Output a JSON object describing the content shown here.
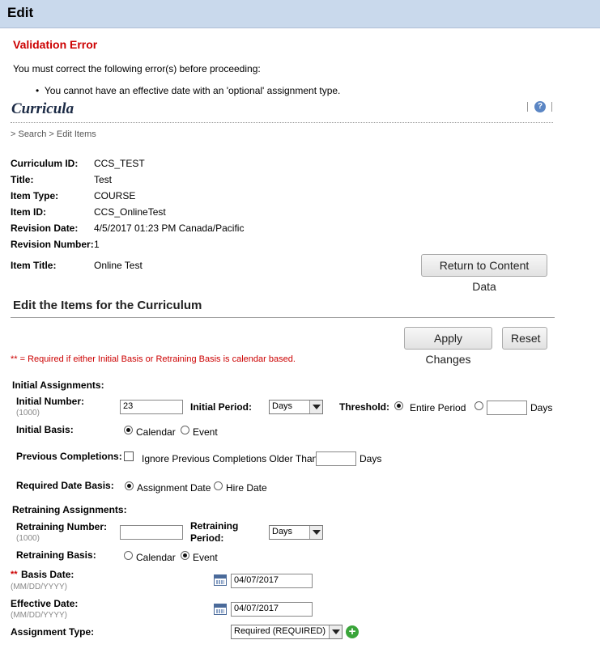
{
  "window": {
    "title": "Edit"
  },
  "validation": {
    "title": "Validation Error",
    "message": "You must correct the following error(s) before proceeding:",
    "errors": [
      "You cannot have an effective date with an 'optional' assignment type."
    ]
  },
  "header": {
    "title": "Curricula",
    "help_icon": "help-icon"
  },
  "breadcrumb": "> Search > Edit Items",
  "details": [
    {
      "label": "Curriculum ID:",
      "value": "CCS_TEST"
    },
    {
      "label": "Title:",
      "value": "Test"
    },
    {
      "label": "Item Type:",
      "value": "COURSE"
    },
    {
      "label": "Item ID:",
      "value": "CCS_OnlineTest"
    },
    {
      "label": "Revision Date:",
      "value": "4/5/2017 01:23 PM Canada/Pacific"
    },
    {
      "label": "Revision Number:",
      "value": "1"
    },
    {
      "label": "Item Title:",
      "value": "Online Test"
    }
  ],
  "buttons": {
    "return": "Return to Content Data",
    "apply": "Apply Changes",
    "reset": "Reset"
  },
  "edit_section": {
    "title": "Edit the Items for the Curriculum",
    "required_note": "** = Required if either Initial Basis or Retraining Basis is calendar based."
  },
  "initial": {
    "heading": "Initial Assignments:",
    "number_label": "Initial Number:",
    "number_hint": "(1000)",
    "number_value": "23",
    "period_label": "Initial Period:",
    "period_value": "Days",
    "threshold_label": "Threshold:",
    "threshold_entire": "Entire Period",
    "threshold_days_value": "",
    "threshold_days_unit": "Days",
    "basis_label": "Initial Basis:",
    "basis_calendar": "Calendar",
    "basis_event": "Event"
  },
  "previous": {
    "label": "Previous Completions:",
    "checkbox_text": "Ignore Previous Completions Older Than",
    "days_value": "",
    "days_unit": "Days"
  },
  "required_basis": {
    "label": "Required Date Basis:",
    "assignment": "Assignment Date",
    "hire": "Hire Date"
  },
  "retraining": {
    "heading": "Retraining Assignments:",
    "number_label": "Retraining Number:",
    "number_hint": "(1000)",
    "number_value": "",
    "period_label_1": "Retraining",
    "period_label_2": "Period:",
    "period_value": "Days",
    "basis_label": "Retraining Basis:",
    "basis_calendar": "Calendar",
    "basis_event": "Event"
  },
  "dates": {
    "required_mark": "**",
    "basis_label": "Basis Date:",
    "basis_hint": "(MM/DD/YYYY)",
    "basis_value": "04/07/2017",
    "effective_label": "Effective Date:",
    "effective_hint": "(MM/DD/YYYY)",
    "effective_value": "04/07/2017"
  },
  "assignment_type": {
    "label": "Assignment Type:",
    "value": "Required (REQUIRED)"
  },
  "colors": {
    "titlebar": "#c9d9ec",
    "error": "#cc0000",
    "add": "#3aa53a"
  }
}
